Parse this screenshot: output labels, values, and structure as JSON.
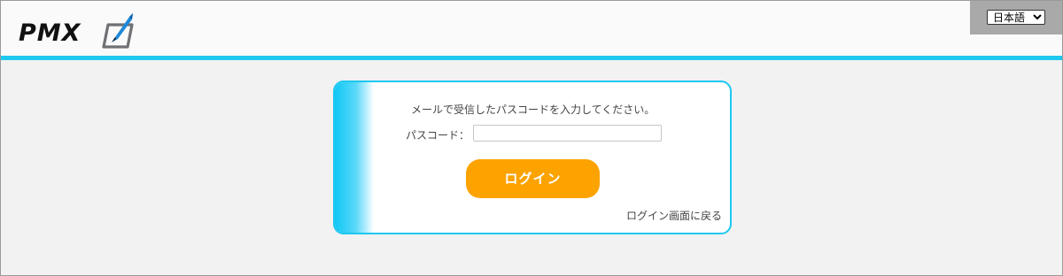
{
  "header": {
    "logo_text": "PMX",
    "language": {
      "selected": "日本語",
      "options": [
        "日本語"
      ]
    }
  },
  "colors": {
    "accent": "#1ec8ef",
    "button": "#fca300",
    "lang_box": "#a9a9a9"
  },
  "login_card": {
    "message": "メールで受信したパスコードを入力してください。",
    "passcode_label": "パスコード：",
    "passcode_value": "",
    "login_button": "ログイン",
    "back_link": "ログイン画面に戻る"
  },
  "icons": [
    "pen-logo-icon"
  ]
}
